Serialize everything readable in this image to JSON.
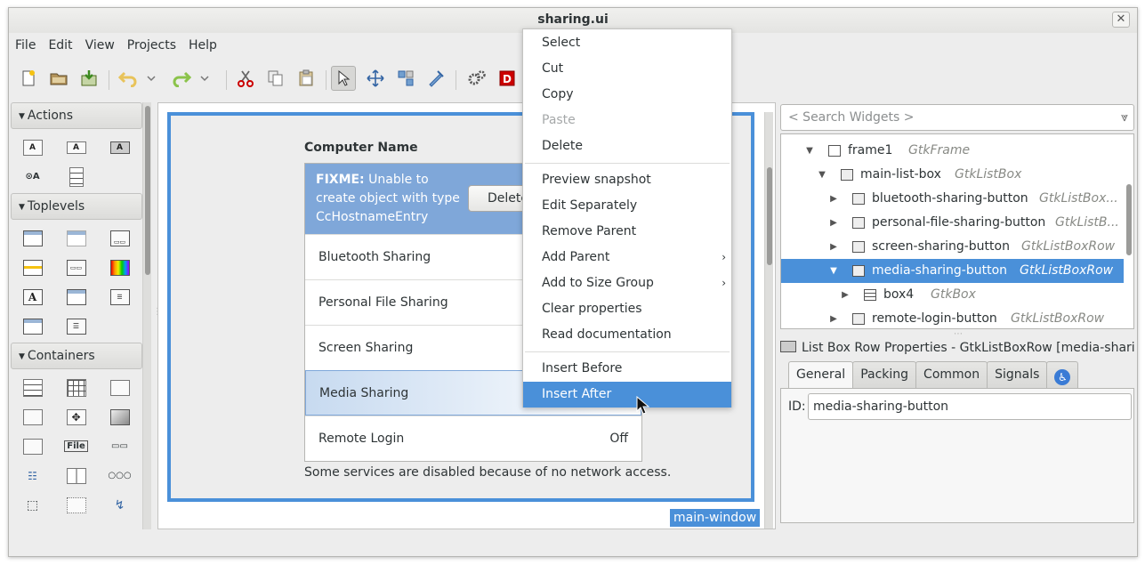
{
  "window": {
    "title": "sharing.ui",
    "close_glyph": "✕"
  },
  "menubar": [
    "File",
    "Edit",
    "View",
    "Projects",
    "Help"
  ],
  "toolbar": {
    "icons": [
      "new-file-icon",
      "open-folder-icon",
      "save-icon",
      "undo-icon",
      "undo-history-icon",
      "redo-icon",
      "redo-history-icon",
      "cut-icon",
      "copy-icon",
      "paste-icon",
      "pointer-icon",
      "drag-resize-icon",
      "align-icon",
      "edit-mode-icon",
      "preferences-icon",
      "devhelp-icon"
    ]
  },
  "palette": {
    "sections": [
      {
        "label": "Actions"
      },
      {
        "label": "Toplevels"
      },
      {
        "label": "Containers"
      }
    ]
  },
  "design": {
    "computer_name_label": "Computer Name",
    "fixme_bold": "FIXME:",
    "fixme_text": "Unable to create object with type CcHostnameEntry",
    "delete_button": "Delete",
    "rows": [
      {
        "label": "Bluetooth Sharing",
        "state": ""
      },
      {
        "label": "Personal File Sharing",
        "state": ""
      },
      {
        "label": "Screen Sharing",
        "state": ""
      },
      {
        "label": "Media Sharing",
        "state": ""
      },
      {
        "label": "Remote Login",
        "state": "Off"
      }
    ],
    "note": "Some services are disabled because of no network access.",
    "main_window_tag": "main-window"
  },
  "inspector": {
    "search_placeholder": "< Search Widgets >",
    "tree": [
      {
        "name": "frame1",
        "type": "GtkFrame"
      },
      {
        "name": "main-list-box",
        "type": "GtkListBox"
      },
      {
        "name": "bluetooth-sharing-button",
        "type": "GtkListBox..."
      },
      {
        "name": "personal-file-sharing-button",
        "type": "GtkListB..."
      },
      {
        "name": "screen-sharing-button",
        "type": "GtkListBoxRow"
      },
      {
        "name": "media-sharing-button",
        "type": "GtkListBoxRow"
      },
      {
        "name": "box4",
        "type": "GtkBox"
      },
      {
        "name": "remote-login-button",
        "type": "GtkListBoxRow"
      }
    ],
    "selected_node": "media-sharing-button"
  },
  "properties": {
    "title": "List Box Row Properties - GtkListBoxRow [media-shari...",
    "tabs": [
      "General",
      "Packing",
      "Common",
      "Signals"
    ],
    "accessibility_tab_icon": "accessibility-icon",
    "id_label": "ID:",
    "id_value": "media-sharing-button"
  },
  "context_menu": {
    "items": [
      {
        "label": "Select",
        "enabled": true
      },
      {
        "label": "Cut",
        "enabled": true
      },
      {
        "label": "Copy",
        "enabled": true
      },
      {
        "label": "Paste",
        "enabled": false
      },
      {
        "label": "Delete",
        "enabled": true
      },
      {
        "label": "Preview snapshot",
        "enabled": true
      },
      {
        "label": "Edit Separately",
        "enabled": true
      },
      {
        "label": "Remove Parent",
        "enabled": true
      },
      {
        "label": "Add Parent",
        "enabled": true,
        "submenu": true
      },
      {
        "label": "Add to Size Group",
        "enabled": true,
        "submenu": true
      },
      {
        "label": "Clear properties",
        "enabled": true
      },
      {
        "label": "Read documentation",
        "enabled": true
      },
      {
        "label": "Insert Before",
        "enabled": true
      },
      {
        "label": "Insert After",
        "enabled": true,
        "highlighted": true
      }
    ],
    "submenu_glyph": "›"
  },
  "colors": {
    "selection": "#4a90d9",
    "fixme_background": "#7fa7d9",
    "window_background": "#ededed"
  }
}
